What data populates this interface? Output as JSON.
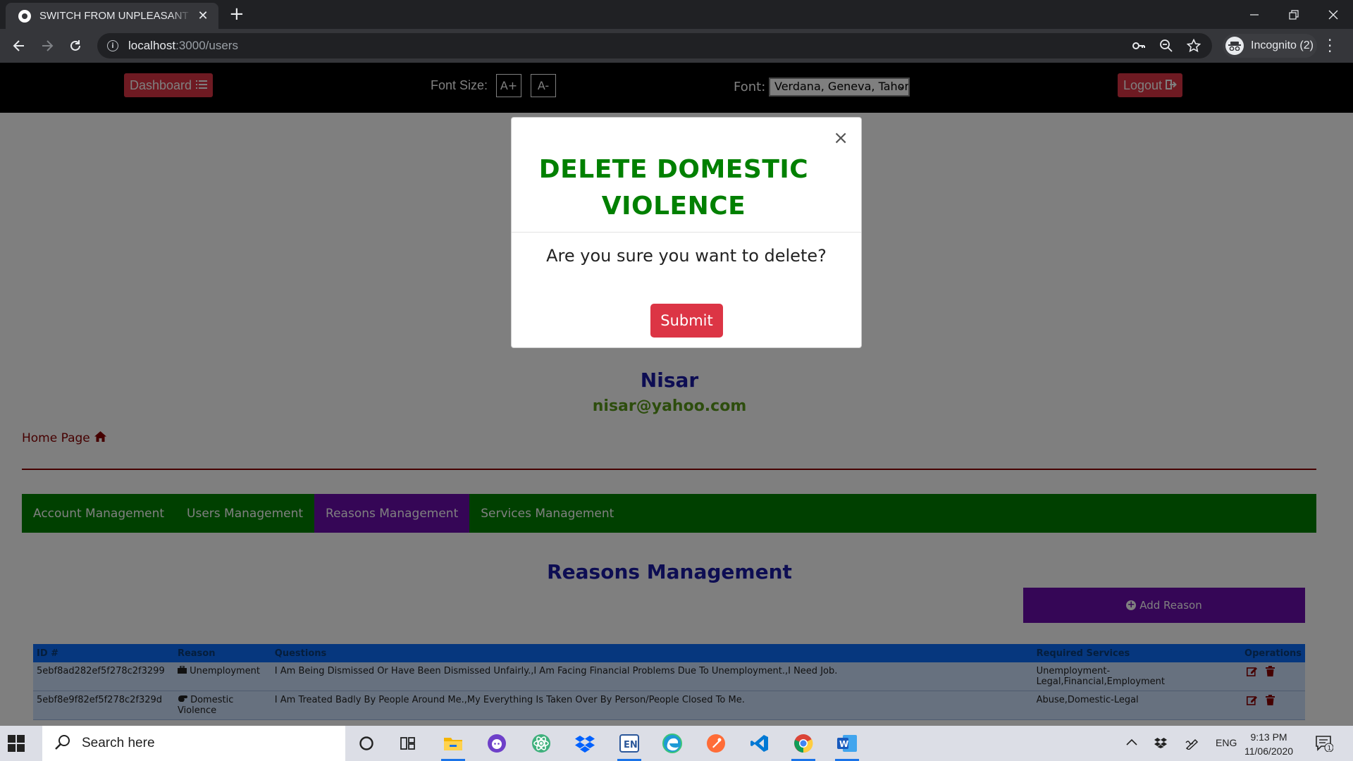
{
  "browser": {
    "tab_title": "SWITCH FROM UNPLEASANT SCREEN",
    "tab_close": "✕",
    "new_tab": "+",
    "url_host": "localhost",
    "url_path": ":3000/users",
    "profile_label": "Incognito (2)"
  },
  "app_nav": {
    "dashboard_label": "Dashboard",
    "font_size_label": "Font Size:",
    "font_increase": "A+",
    "font_decrease": "A-",
    "font_label": "Font:",
    "font_selected": "Verdana, Geneva, Tahoma",
    "logout_label": "Logout"
  },
  "profile": {
    "name": "Nisar",
    "email": "nisar@yahoo.com"
  },
  "home_link": "Home Page",
  "tabs": [
    {
      "label": "Account Management",
      "active": false
    },
    {
      "label": "Users Management",
      "active": false
    },
    {
      "label": "Reasons Management",
      "active": true
    },
    {
      "label": "Services Management",
      "active": false
    }
  ],
  "section_title": "Reasons Management",
  "add_button": "Add Reason",
  "table": {
    "headers": [
      "ID #",
      "Reason",
      "Questions",
      "Required Services",
      "Operations"
    ],
    "rows": [
      {
        "id": "5ebf8ad282ef5f278c2f3299",
        "reason": "Unemployment",
        "questions": "I Am Being Dismissed Or Have Been Dismissed Unfairly.,I Am Facing Financial Problems Due To Unemployment.,I Need Job.",
        "services": "Unemployment-Legal,Financial,Employment"
      },
      {
        "id": "5ebf8e9f82ef5f278c2f329d",
        "reason": "Domestic Violence",
        "questions": "I Am Treated Badly By People Around Me.,My Everything Is Taken Over By Person/People Closed To Me.",
        "services": "Abuse,Domestic-Legal"
      }
    ]
  },
  "modal": {
    "title": "DELETE DOMESTIC VIOLENCE",
    "body": "Are you sure you want to delete?",
    "submit_label": "Submit",
    "close_label": "×"
  },
  "taskbar": {
    "search_placeholder": "Search here",
    "language": "ENG",
    "time": "9:13 PM",
    "date": "11/06/2020",
    "notification_count": "1"
  },
  "colors": {
    "accent_red": "#dc3545",
    "nav_green": "#008000",
    "active_purple": "#6a0dad",
    "title_blue": "#1a1aa6"
  }
}
